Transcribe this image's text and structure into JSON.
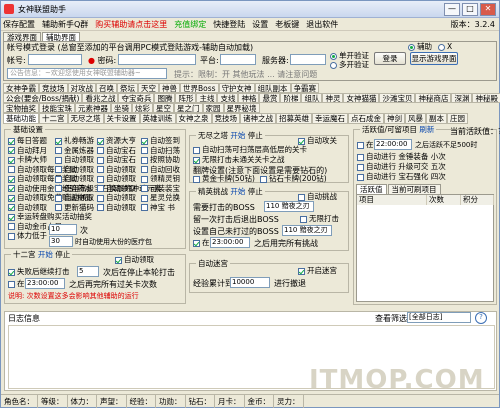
{
  "window": {
    "title": "女神联盟助手",
    "min": "—",
    "max": "□",
    "close": "✕"
  },
  "menu": {
    "items": [
      "保存配置",
      "辅助新手Q群",
      "购买辅助请点击这里",
      "充值绑定",
      "快捷登陆",
      "设置",
      "老板键",
      "退出软件"
    ],
    "version": "版本：3.2.4"
  },
  "top_tabs": [
    "游戏界面",
    "辅助界面"
  ],
  "account": {
    "section_label": "帐号模式登录 (总窗至添加的平台调用PC模式登陆游戏-辅助自动加载)",
    "account_label": "帐号:",
    "password_label": "密码:",
    "platform_label": "平台:",
    "server_label": "服务器:",
    "single_label": "单开验证",
    "multi_label": "多开验证",
    "login_btn": "登录",
    "show_game_btn": "显示游戏界面",
    "assist_label": "辅助",
    "x_label": "X",
    "notice_placeholder": "公告信息：~欢迎您使用女神联盟辅助器~",
    "tip_text": "提示：限制：开 其他玩法 ... 请注意问题"
  },
  "func_tabs": [
    [
      "女神争霸",
      "竞技场",
      "对攻战",
      "召唤",
      "祭坛",
      "天空",
      "神兽",
      "世界Boss",
      "守护女神",
      "组队副本",
      "争霸赛"
    ],
    [
      "公会(要会/Boss/捐献)",
      "看兆之战",
      "夺宝奇兵",
      "图腾",
      "阵形",
      "主线",
      "支线",
      "神格",
      "悬赏",
      "阶梯",
      "组队",
      "神灵",
      "女神猫猫",
      "沙滩宝贝",
      "神秘商店",
      "深渊",
      "神秘殿"
    ],
    [
      "宝物抽奖",
      "技能宝珠",
      "元素神器",
      "坐骑",
      "炫彩",
      "星空",
      "星之门",
      "家园",
      "星界秘境"
    ],
    [
      "基础功能",
      "十二宫",
      "无尽之塔",
      "关卡设置",
      "英雄训练",
      "女神之泉",
      "竞技场",
      "诸神之战",
      "招募英雄",
      "幸运魔石",
      "点石成金",
      "神剑",
      "风暴",
      "副本",
      "庄园"
    ]
  ],
  "basic": {
    "title": "基础设置",
    "col1": [
      {
        "label": "每日答题",
        "on": true
      },
      {
        "label": "自动拜月",
        "on": true
      },
      {
        "label": "卡牌大师",
        "on": true
      },
      {
        "label": "自动领取每日奖励",
        "on": false
      },
      {
        "label": "自动领取每日奖励",
        "on": true
      },
      {
        "label": "自动使用金铂经验药水",
        "on": true
      },
      {
        "label": "自动领取免费赠送物品",
        "on": true
      },
      {
        "label": "自动领取",
        "on": true
      },
      {
        "label": "幸运转盘购买活动抽奖",
        "on": true
      },
      {
        "label": "自动金币占星",
        "on": false
      },
      {
        "label": "体力低于",
        "on": false
      }
    ],
    "col2": [
      {
        "label": "礼券畅游",
        "on": true
      },
      {
        "label": "金属炼器",
        "on": false
      },
      {
        "label": "自动领取",
        "on": false
      },
      {
        "label": "自动领取",
        "on": false
      },
      {
        "label": "自动领取",
        "on": false
      },
      {
        "label": "使用高级宝石换取的冲动元素",
        "on": false
      },
      {
        "label": "自动领取",
        "on": false
      },
      {
        "label": "更新猫码",
        "on": false
      }
    ],
    "col3": [
      {
        "label": "资源大亨",
        "on": true
      },
      {
        "label": "自动宝石",
        "on": false
      },
      {
        "label": "自动宝石",
        "on": false
      },
      {
        "label": "自动领取",
        "on": false
      },
      {
        "label": "自动领取",
        "on": false
      },
      {
        "label": "自动领取",
        "on": false
      },
      {
        "label": "自动领取",
        "on": false
      },
      {
        "label": "自动领取",
        "on": false
      }
    ],
    "col4": [
      {
        "label": "自动签到",
        "on": true
      },
      {
        "label": "自动扫荡",
        "on": false
      },
      {
        "label": "按照协助",
        "on": false
      },
      {
        "label": "自动回收",
        "on": false
      },
      {
        "label": "领精灵钥",
        "on": false
      },
      {
        "label": "可装装宝",
        "on": false
      },
      {
        "label": "星灵兑换",
        "on": false
      },
      {
        "label": "神宝 书",
        "on": false
      }
    ],
    "star_value": "10",
    "stamina_value": "30",
    "stamina_suffix": "时自动使用大份的医疗包",
    "star_suffix": "次"
  },
  "zodiac": {
    "title": "十二宫",
    "start": "开始",
    "stop": "停止",
    "auto_label": "自动领取",
    "fail_label": "失败后继续打击",
    "fail_value": "5",
    "fail_suffix": "次后在停止本轮打击",
    "time_label": "在",
    "time_value": "23:00:00",
    "time_suffix": "之后再完所有过关卡次数",
    "note": "说明: 次数设置这多会影响其他辅助的运行"
  },
  "tower": {
    "title": "无尽之塔",
    "start": "开始",
    "stop": "停止",
    "auto_attack": "自动攻关",
    "row1": "自动扫荡可扫荡层高低层的关卡",
    "row2": "无限打击未通关关卡之战",
    "row3": "翻牌设置(注意下面设置是需要钻石的)",
    "row4a": "黄金卡牌(50钻)",
    "row4b": "钻石卡牌(200钻)"
  },
  "elite": {
    "title": "精英挑战",
    "start": "开始",
    "stop": "停止",
    "auto_label": "自动挑战",
    "need_label": "需要打击的BOSS",
    "need_value": "110 黯夜之刃",
    "warn_label": "留一次打击后退出BOSS",
    "infinite_label": "无限打击",
    "setting_label": "设置自己未打过的BOSS",
    "setting_value": "110 黯夜之刃",
    "time_label": "在",
    "time_value": "23:00:00",
    "time_suffix": "之后用完所有挑战"
  },
  "maze": {
    "title": "自动迷宫",
    "start_label": "开启迷宫",
    "exp_label": "经验累计到",
    "exp_value": "10000",
    "exp_suffix": "进行撤退"
  },
  "activity": {
    "title": "活跃值/可留项目",
    "refresh": "刷新",
    "current": "当前活跃值：?",
    "time_label": "在",
    "time_value": "22:00:00",
    "time_suffix": "之后活跃不足500时",
    "rows": [
      {
        "label": "自动进行",
        "value": "金锤装备"
      },
      {
        "label": "自动进行",
        "value": "升级可交"
      },
      {
        "label": "自动进行",
        "value": "宝石强化"
      }
    ],
    "row_values2": [
      "小次",
      "五次",
      "四次"
    ],
    "tabs": [
      "活跃值",
      "当前可刷项目"
    ],
    "columns": [
      "项目",
      "次数",
      "积分"
    ]
  },
  "log": {
    "title": "日志信息",
    "filter_label": "查看筛选：",
    "filter_value": "[全部日志]"
  },
  "status_bar": [
    "角色名：",
    "等级：",
    "体力：",
    "声望：",
    "经验：",
    "功勋：",
    "钻石：",
    "月卡：",
    "金币：",
    "灵力："
  ]
}
